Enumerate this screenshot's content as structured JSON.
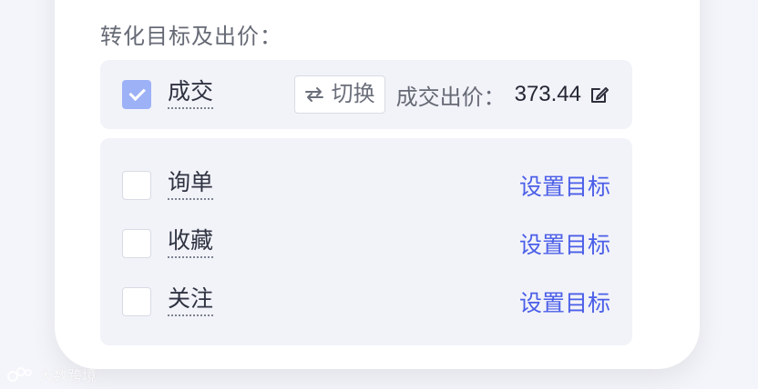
{
  "section": {
    "title": "转化目标及出价："
  },
  "primary_goal": {
    "label": "成交",
    "checked": true,
    "switch_label": "切换",
    "bid_label": "成交出价：",
    "bid_value": "373.44"
  },
  "other_goals": [
    {
      "label": "询单",
      "checked": false,
      "action": "设置目标"
    },
    {
      "label": "收藏",
      "checked": false,
      "action": "设置目标"
    },
    {
      "label": "关注",
      "checked": false,
      "action": "设置目标"
    }
  ],
  "watermark": {
    "text": "大数跨境"
  },
  "colors": {
    "accent": "#4a5ee8",
    "checked_bg": "#9db1f7",
    "card_bg": "#f2f3f9"
  }
}
